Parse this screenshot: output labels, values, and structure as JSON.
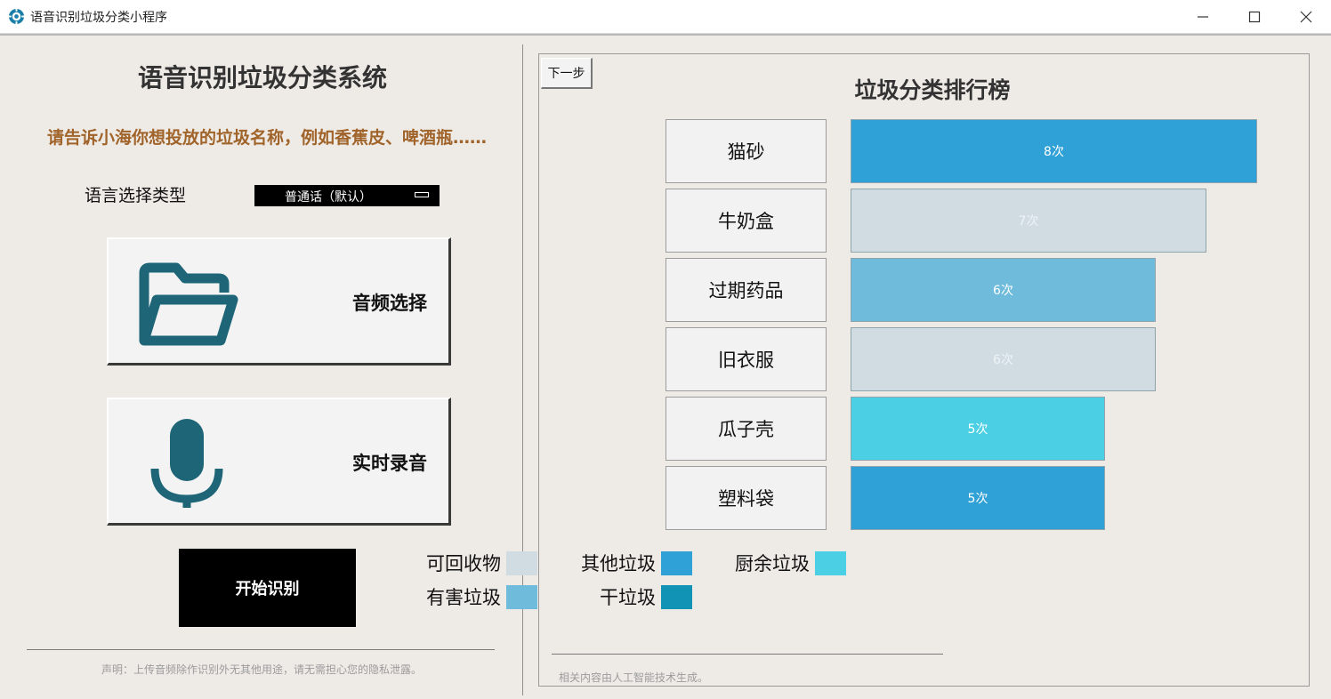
{
  "window": {
    "title": "语音识别垃圾分类小程序"
  },
  "left": {
    "title": "语音识别垃圾分类系统",
    "prompt": "请告诉小海你想投放的垃圾名称，例如香蕉皮、啤酒瓶……",
    "language_label": "语言选择类型",
    "language_value": "普通话（默认）",
    "audio_button": "音频选择",
    "record_button": "实时录音",
    "start_button": "开始识别",
    "disclaimer": "声明：上传音频除作识别外无其他用途，请无需担心您的隐私泄露。"
  },
  "right": {
    "next_button": "下一步",
    "title": "垃圾分类排行榜",
    "note": "相关内容由人工智能技术生成。"
  },
  "chart_data": {
    "type": "bar",
    "orientation": "horizontal",
    "title": "垃圾分类排行榜",
    "categories": [
      "猫砂",
      "牛奶盒",
      "过期药品",
      "旧衣服",
      "瓜子壳",
      "塑料袋"
    ],
    "values": [
      8,
      7,
      6,
      6,
      5,
      5
    ],
    "value_labels": [
      "8次",
      "7次",
      "6次",
      "6次",
      "5次",
      "5次"
    ],
    "classes": [
      "其他垃圾",
      "可回收物",
      "有害垃圾",
      "可回收物",
      "厨余垃圾",
      "其他垃圾"
    ],
    "legend": [
      {
        "name": "可回收物",
        "color": "#d0dce2"
      },
      {
        "name": "其他垃圾",
        "color": "#30a1d6"
      },
      {
        "name": "厨余垃圾",
        "color": "#4bcfe4"
      },
      {
        "name": "有害垃圾",
        "color": "#6fbbdb"
      },
      {
        "name": "干垃圾",
        "color": "#1093b4"
      }
    ]
  }
}
